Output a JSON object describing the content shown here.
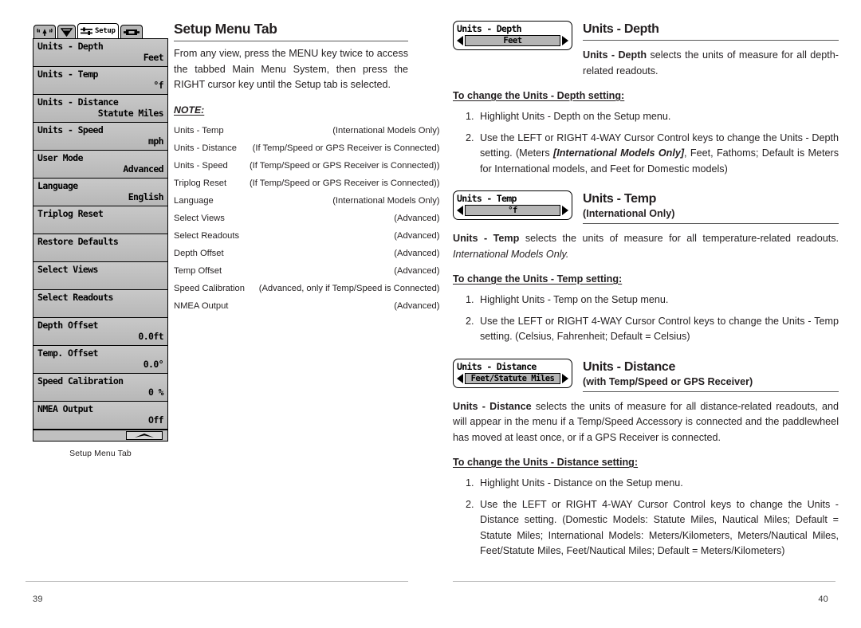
{
  "left_page": {
    "folio": "39",
    "device": {
      "tabs": [
        {
          "name": "alarm-tab",
          "label": "",
          "icon": "alarm-bell-icon",
          "active": false
        },
        {
          "name": "sonar-tab",
          "label": "",
          "icon": "sonar-cone-icon",
          "active": false
        },
        {
          "name": "setup-tab",
          "label": "Setup",
          "icon": "sliders-icon",
          "active": true
        },
        {
          "name": "accessory-tab",
          "label": "",
          "icon": "accessory-box-icon",
          "active": false
        }
      ],
      "menu_items": [
        {
          "name": "Units - Depth",
          "value": "Feet"
        },
        {
          "name": "Units - Temp",
          "value": "°f"
        },
        {
          "name": "Units - Distance",
          "value": "Statute Miles"
        },
        {
          "name": "Units - Speed",
          "value": "mph"
        },
        {
          "name": "User Mode",
          "value": "Advanced"
        },
        {
          "name": "Language",
          "value": "English"
        },
        {
          "name": "Triplog Reset",
          "value": ""
        },
        {
          "name": "Restore Defaults",
          "value": ""
        },
        {
          "name": "Select Views",
          "value": ""
        },
        {
          "name": "Select Readouts",
          "value": ""
        },
        {
          "name": "Depth Offset",
          "value": "0.0ft"
        },
        {
          "name": "Temp. Offset",
          "value": "0.0°"
        },
        {
          "name": "Speed Calibration",
          "value": "0 %"
        },
        {
          "name": "NMEA Output",
          "value": "Off"
        }
      ],
      "caption": "Setup Menu Tab"
    },
    "section": {
      "title": "Setup Menu Tab",
      "intro": "From any view, press the MENU key twice to access the tabbed Main Menu System, then press the RIGHT cursor key until the Setup tab is selected.",
      "note_label": "NOTE:",
      "notes": [
        {
          "item": "Units - Temp",
          "condition": "(International Models Only)"
        },
        {
          "item": "Units - Distance",
          "condition": "(If Temp/Speed or GPS Receiver is Connected)"
        },
        {
          "item": "Units - Speed",
          "condition": "(If Temp/Speed or GPS Receiver is Connected))"
        },
        {
          "item": "Triplog Reset",
          "condition": "(If Temp/Speed or GPS Receiver is Connected))"
        },
        {
          "item": "Language",
          "condition": "(International Models Only)"
        },
        {
          "item": "Select Views",
          "condition": "(Advanced)"
        },
        {
          "item": "Select Readouts",
          "condition": "(Advanced)"
        },
        {
          "item": "Depth Offset",
          "condition": "(Advanced)"
        },
        {
          "item": "Temp Offset",
          "condition": "(Advanced)"
        },
        {
          "item": "Speed Calibration",
          "condition": "(Advanced, only if Temp/Speed is Connected)"
        },
        {
          "item": "NMEA Output",
          "condition": "(Advanced)"
        }
      ]
    }
  },
  "right_page": {
    "folio": "40",
    "sections": [
      {
        "widget": {
          "title": "Units - Depth",
          "value": "Feet",
          "left_arrow": "left-arrow-icon",
          "right_arrow": "right-arrow-icon"
        },
        "heading": "Units - Depth",
        "subheading": "",
        "description_bold": "Units - Depth",
        "description_rest": " selects the units of measure for all depth-related readouts.",
        "to_change": "To change the Units - Depth setting:",
        "steps": [
          {
            "pre": "Highlight Units - Depth on the Setup menu.",
            "italic": "",
            "post": ""
          },
          {
            "pre": "Use the LEFT or RIGHT 4-WAY Cursor Control keys to change the Units - Depth setting. (Meters ",
            "italic": "[International Models Only]",
            "post": ", Feet, Fathoms; Default is Meters for International models, and Feet for Domestic models)"
          }
        ]
      },
      {
        "widget": {
          "title": "Units - Temp",
          "value": "°f",
          "left_arrow": "left-arrow-icon",
          "right_arrow": "right-arrow-icon"
        },
        "heading": "Units - Temp",
        "subheading": "(International Only)",
        "description_bold": "Units - Temp",
        "description_rest": " selects the units of measure for all temperature-related readouts. ",
        "description_italic": "International Models Only.",
        "to_change": "To change the Units - Temp setting:",
        "steps": [
          {
            "pre": "Highlight Units - Temp on the Setup menu.",
            "italic": "",
            "post": ""
          },
          {
            "pre": "Use the LEFT or RIGHT 4-WAY Cursor Control keys to change the Units - Temp setting. (Celsius, Fahrenheit; Default = Celsius)",
            "italic": "",
            "post": ""
          }
        ]
      },
      {
        "widget": {
          "title": "Units - Distance",
          "value": "Feet/Statute Miles",
          "left_arrow": "left-arrow-icon",
          "right_arrow": "right-arrow-icon"
        },
        "heading": "Units - Distance",
        "subheading": "(with Temp/Speed or GPS Receiver)",
        "description_bold": "Units - Distance",
        "description_rest": " selects the units of measure for all distance-related readouts, and will appear in the menu if a Temp/Speed Accessory is connected and the paddlewheel has moved at least once, or if a GPS Receiver is connected.",
        "to_change": "To change the Units - Distance setting:",
        "steps": [
          {
            "pre": "Highlight Units - Distance on the Setup menu.",
            "italic": "",
            "post": ""
          },
          {
            "pre": "Use the LEFT or RIGHT 4-WAY Cursor Control keys to change the Units - Distance setting. (Domestic Models: Statute Miles, Nautical Miles; Default = Statute Miles; International Models: Meters/Kilometers, Meters/Nautical Miles, Feet/Statute Miles, Feet/Nautical Miles; Default = Meters/Kilometers)",
            "italic": "",
            "post": ""
          }
        ]
      }
    ]
  }
}
